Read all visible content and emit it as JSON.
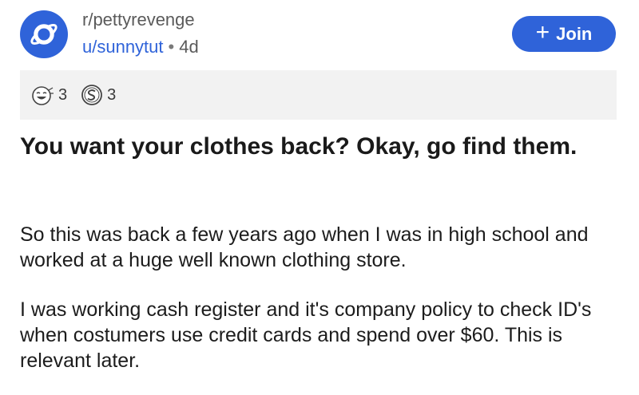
{
  "post": {
    "subreddit": "r/pettyrevenge",
    "username": "u/sunnytut",
    "separator": "•",
    "age": "4d",
    "join_label": "Join",
    "join_plus": "+",
    "title": "You want your clothes back? Okay, go find them.",
    "paragraphs": [
      "So this was back a few years ago when I was in high school and worked at a huge well known clothing store.",
      "I was working cash register and it's company policy to check ID's when costumers use credit cards and spend over $60. This is relevant later."
    ]
  },
  "awards": [
    {
      "icon": "laughing-face-icon",
      "count": "3"
    },
    {
      "icon": "silver-coin-icon",
      "count": "3"
    }
  ],
  "colors": {
    "accent": "#2f63d9",
    "award_bar": "#f2f2f2",
    "meta_text": "#5a5a5a"
  }
}
